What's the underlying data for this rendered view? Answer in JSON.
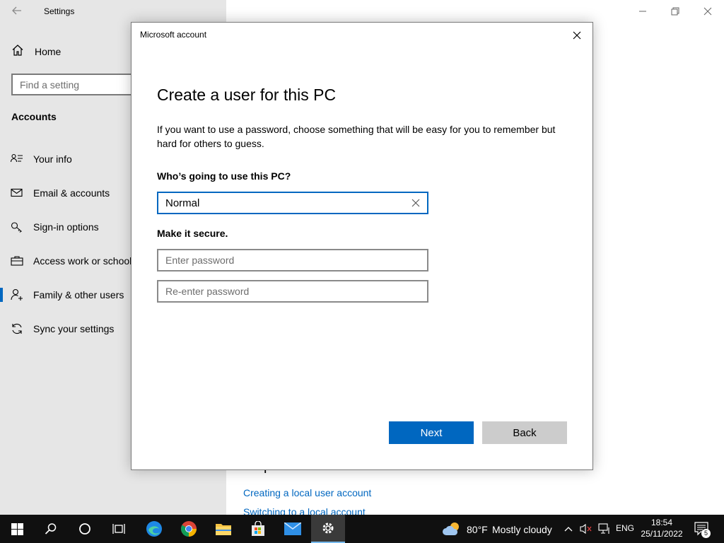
{
  "settings": {
    "title": "Settings",
    "home_label": "Home",
    "search_placeholder": "Find a setting",
    "section_title": "Accounts",
    "nav": [
      {
        "label": "Your info",
        "icon": "person-card-icon"
      },
      {
        "label": "Email & accounts",
        "icon": "mail-icon"
      },
      {
        "label": "Sign-in options",
        "icon": "key-icon"
      },
      {
        "label": "Access work or school",
        "icon": "briefcase-icon"
      },
      {
        "label": "Family & other users",
        "icon": "person-add-icon",
        "selected": true
      },
      {
        "label": "Sync your settings",
        "icon": "sync-icon"
      }
    ],
    "help_heading": "Help from the web",
    "help_links": [
      "Creating a local user account",
      "Switching to a local account"
    ]
  },
  "dialog": {
    "title": "Microsoft account",
    "heading": "Create a user for this PC",
    "description": "If you want to use a password, choose something that will be easy for you to remember but hard for others to guess.",
    "who_label": "Who’s going to use this PC?",
    "username_value": "Normal",
    "secure_label": "Make it secure.",
    "password_placeholder": "Enter password",
    "reenter_placeholder": "Re-enter password",
    "next_label": "Next",
    "back_label": "Back"
  },
  "taskbar": {
    "weather_temp": "80°F",
    "weather_desc": "Mostly cloudy",
    "language": "ENG",
    "time": "18:54",
    "date": "25/11/2022",
    "notification_count": "5"
  },
  "colors": {
    "accent": "#0067c0",
    "sidebar_bg": "#e6e6e6",
    "taskbar_bg": "#101010"
  }
}
